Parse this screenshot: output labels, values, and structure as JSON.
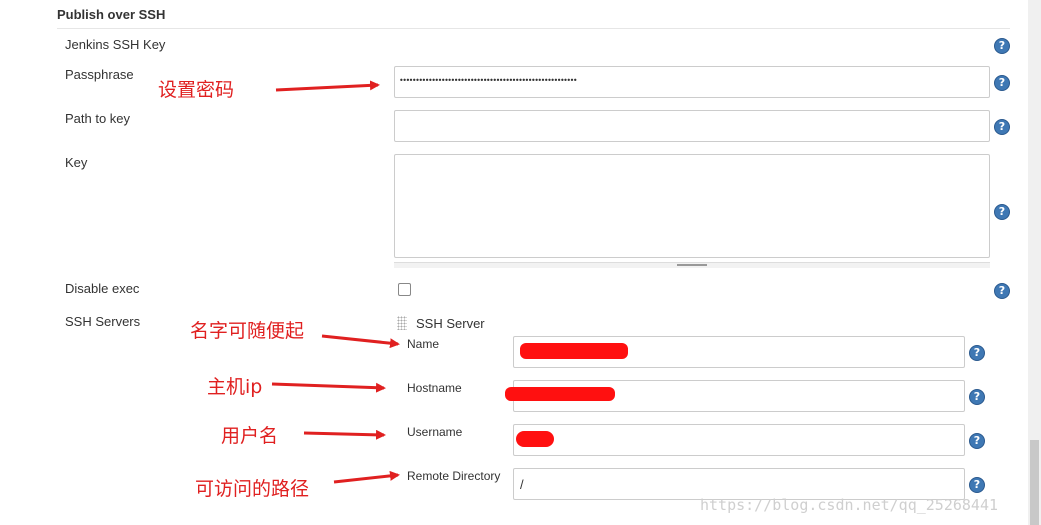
{
  "section": {
    "title": "Publish over SSH"
  },
  "fields": {
    "jenkins_ssh_key_label": "Jenkins SSH Key",
    "passphrase_label": "Passphrase",
    "passphrase_value": "•••••••••••••••••••••••••••••••••••••••••••••••••••••••",
    "path_to_key_label": "Path to key",
    "path_to_key_value": "",
    "key_label": "Key",
    "key_value": "",
    "disable_exec_label": "Disable exec",
    "disable_exec_checked": false,
    "ssh_servers_label": "SSH Servers"
  },
  "ssh_server": {
    "header": "SSH Server",
    "name_label": "Name",
    "name_value": "",
    "hostname_label": "Hostname",
    "hostname_value": "",
    "username_label": "Username",
    "username_value": "",
    "remote_dir_label": "Remote Directory",
    "remote_dir_value": "/"
  },
  "help_icon_glyph": "?",
  "annotations": {
    "passphrase": "设置密码",
    "name": "名字可随便起",
    "hostname": "主机ip",
    "username": "用户名",
    "remote_dir": "可访问的路径"
  },
  "watermark": "https://blog.csdn.net/qq_25268441",
  "colors": {
    "annotation_red": "#e02020",
    "help_icon_blue": "#3f78b4"
  },
  "icons": {
    "help": "help-icon",
    "drag_handle": "drag-handle-icon",
    "arrow": "red-arrow-icon"
  }
}
